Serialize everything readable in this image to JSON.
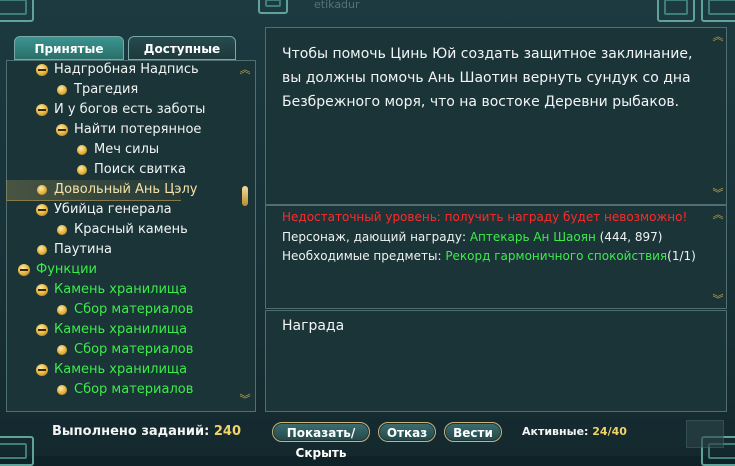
{
  "watermark": "etikadur",
  "tabs": [
    {
      "label": "Принятые",
      "active": true
    },
    {
      "label": "Доступные",
      "active": false
    }
  ],
  "quest_tree": [
    {
      "label": "Надгробная Надпись",
      "icon": "minus",
      "color": "white",
      "level": 1
    },
    {
      "label": "Трагедия",
      "icon": "bullet",
      "color": "white",
      "level": 2
    },
    {
      "label": "И у богов есть заботы",
      "icon": "minus",
      "color": "white",
      "level": 1
    },
    {
      "label": "Найти потерянное",
      "icon": "minus",
      "color": "white",
      "level": 2
    },
    {
      "label": "Меч силы",
      "icon": "bullet",
      "color": "white",
      "level": 3
    },
    {
      "label": "Поиск свитка",
      "icon": "bullet",
      "color": "white",
      "level": 3
    },
    {
      "label": "Довольный Ань Цэлу",
      "icon": "bullet",
      "color": "white",
      "level": 1,
      "selected": true
    },
    {
      "label": "Убийца генерала",
      "icon": "minus",
      "color": "white",
      "level": 1
    },
    {
      "label": "Красный камень",
      "icon": "bullet",
      "color": "white",
      "level": 2
    },
    {
      "label": "Паутина",
      "icon": "bullet",
      "color": "white",
      "level": 1
    },
    {
      "label": "Функции",
      "icon": "minus",
      "color": "green",
      "level": 0
    },
    {
      "label": "Камень хранилища",
      "icon": "minus",
      "color": "green",
      "level": 1
    },
    {
      "label": "Сбор материалов",
      "icon": "bullet",
      "color": "green",
      "level": 2
    },
    {
      "label": "Камень хранилища",
      "icon": "minus",
      "color": "green",
      "level": 1
    },
    {
      "label": "Сбор материалов",
      "icon": "bullet",
      "color": "green",
      "level": 2
    },
    {
      "label": "Камень хранилища",
      "icon": "minus",
      "color": "green",
      "level": 1
    },
    {
      "label": "Сбор материалов",
      "icon": "bullet",
      "color": "green",
      "level": 2
    }
  ],
  "description": "Чтобы помочь Цинь Юй создать защитное заклинание, вы должны помочь Ань Шаотин вернуть сундук со дна Безбрежного моря, что на востоке Деревни рыбаков.",
  "warning": "Недостаточный уровень: получить награду будет невозможно!",
  "reward_giver": {
    "label": "Персонаж, дающий награду: ",
    "name": "Аптекарь Ан Шаоян",
    "coords": " (444, 897)"
  },
  "required_items": {
    "label": "Необходимые предметы: ",
    "name": "Рекорд гармоничного спокойствия",
    "count": "(1/1)"
  },
  "reward_title": "Награда",
  "footer": {
    "completed_label": "Выполнено заданий:",
    "completed_value": "240",
    "buttons": {
      "toggle": "Показать/Скрыть",
      "cancel": "Отказ",
      "track": "Вести"
    },
    "active_label": "Активные:",
    "active_value": "24/40"
  },
  "colors": {
    "accent_gold": "#f0d36a",
    "green_text": "#3cec4a",
    "warning_red": "#ff2a2a",
    "teal_tab": "#2a6f6a"
  }
}
